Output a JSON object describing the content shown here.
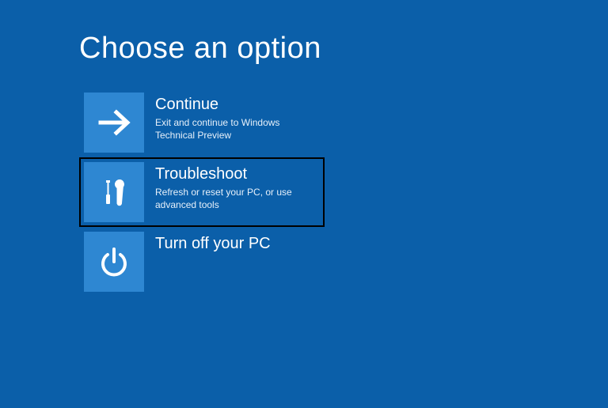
{
  "title": "Choose an option",
  "options": {
    "continue": {
      "title": "Continue",
      "desc": "Exit and continue to Windows Technical Preview"
    },
    "troubleshoot": {
      "title": "Troubleshoot",
      "desc": "Refresh or reset your PC, or use advanced tools"
    },
    "turnoff": {
      "title": "Turn off your PC",
      "desc": ""
    }
  },
  "colors": {
    "background": "#0b5fa9",
    "tile": "#2e87d2",
    "highlight_border": "#000000"
  }
}
